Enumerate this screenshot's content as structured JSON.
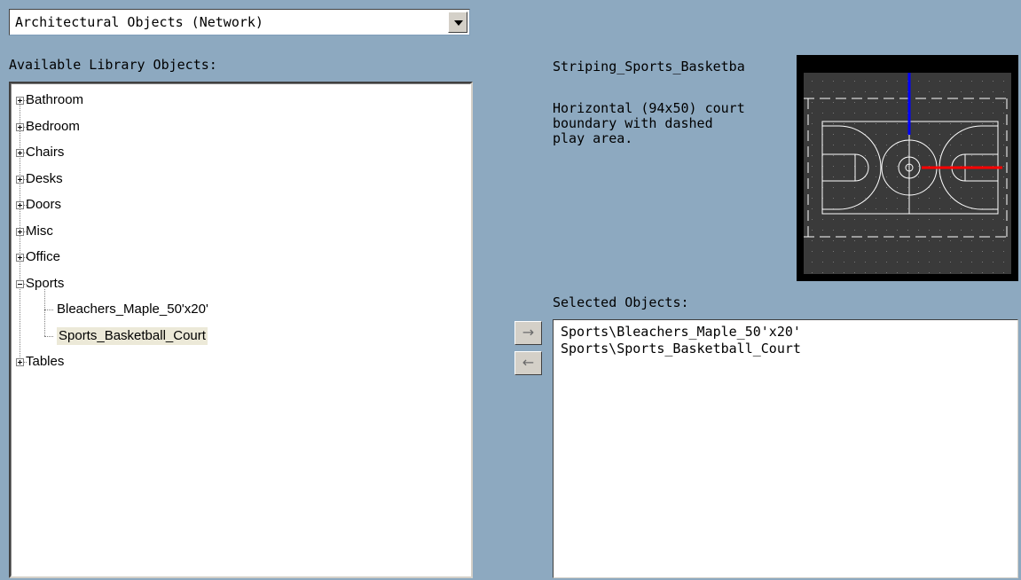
{
  "dropdown": {
    "value": "Architectural Objects (Network)"
  },
  "labels": {
    "available": "Available Library Objects:",
    "selected": "Selected Objects:"
  },
  "tree": [
    {
      "label": "Bathroom",
      "expanded": false
    },
    {
      "label": "Bedroom",
      "expanded": false
    },
    {
      "label": "Chairs",
      "expanded": false
    },
    {
      "label": "Desks",
      "expanded": false
    },
    {
      "label": "Doors",
      "expanded": false
    },
    {
      "label": "Misc",
      "expanded": false
    },
    {
      "label": "Office",
      "expanded": false
    },
    {
      "label": "Sports",
      "expanded": true,
      "children": [
        "Bleachers_Maple_50'x20'",
        "Sports_Basketball_Court"
      ]
    },
    {
      "label": "Tables",
      "expanded": false
    }
  ],
  "preview": {
    "name": "Striping_Sports_Basketba",
    "description_lines": [
      "Horizontal (94x50) court",
      "boundary with dashed",
      "play area."
    ]
  },
  "buttons": {
    "add": "→",
    "remove": "←"
  },
  "selected_objects": [
    "Sports\\Bleachers_Maple_50'x20'",
    "Sports\\Sports_Basketball_Court"
  ],
  "colors": {
    "background": "#8da9c0",
    "preview_bg": "#3a3a3a",
    "axis_y": "#0000ff",
    "axis_x": "#ff0000"
  }
}
